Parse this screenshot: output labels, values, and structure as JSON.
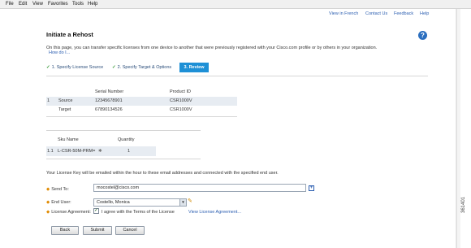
{
  "menubar": {
    "items": [
      "File",
      "Edit",
      "View",
      "Favorites",
      "Tools",
      "Help"
    ]
  },
  "top_links": [
    "View in French",
    "Contact Us",
    "Feedback",
    "Help"
  ],
  "page": {
    "title": "Initiate a Rehost",
    "help_icon": "?",
    "description": "On this page, you can transfer specific licenses from one device to another that were previously registered with your Cisco.com profile or by others in your organization.",
    "how_do_i": "How do I..."
  },
  "steps": [
    {
      "label": "1. Specify License Source",
      "done": true
    },
    {
      "label": "2. Specify Target & Options",
      "done": true
    },
    {
      "label": "3. Review",
      "active": true
    }
  ],
  "device_table": {
    "headers": [
      "Serial Number",
      "Product ID"
    ],
    "rows": [
      {
        "index": "1",
        "role": "Source",
        "serial": "12345678901",
        "product": "CSR1000V"
      },
      {
        "index": "",
        "role": "Target",
        "serial": "67890134526",
        "product": "CSR1000V"
      }
    ]
  },
  "sku_table": {
    "headers": [
      "Sku Name",
      "Quantity"
    ],
    "rows": [
      {
        "index": "1.1",
        "sku": "L-CSR-50M-PRM=",
        "quantity": "1"
      }
    ]
  },
  "note": "Your License Key will be emailed within the hour to these email addresses and connected with the specified end user.",
  "form": {
    "send_to_label": "Send To:",
    "send_to_value": "mocostel@cisco.com",
    "end_user_label": "End User:",
    "end_user_value": "Costello, Monica",
    "license_label": "License Agreement:",
    "agree_text": "I agree with the Terms of the License",
    "view_license": "View License Agreement..."
  },
  "buttons": {
    "back": "Back",
    "submit": "Submit",
    "cancel": "Cancel"
  },
  "figure_number": "361401",
  "icons": {
    "check": "check-icon",
    "help": "help-icon",
    "add": "add-icon",
    "edit": "pencil-icon",
    "dropdown": "chevron-down-icon"
  },
  "colors": {
    "accent": "#1e90d6",
    "link": "#2a5db0",
    "row_highlight": "#e7ecf2",
    "required": "#e08a00",
    "check": "#3a9a3a"
  }
}
